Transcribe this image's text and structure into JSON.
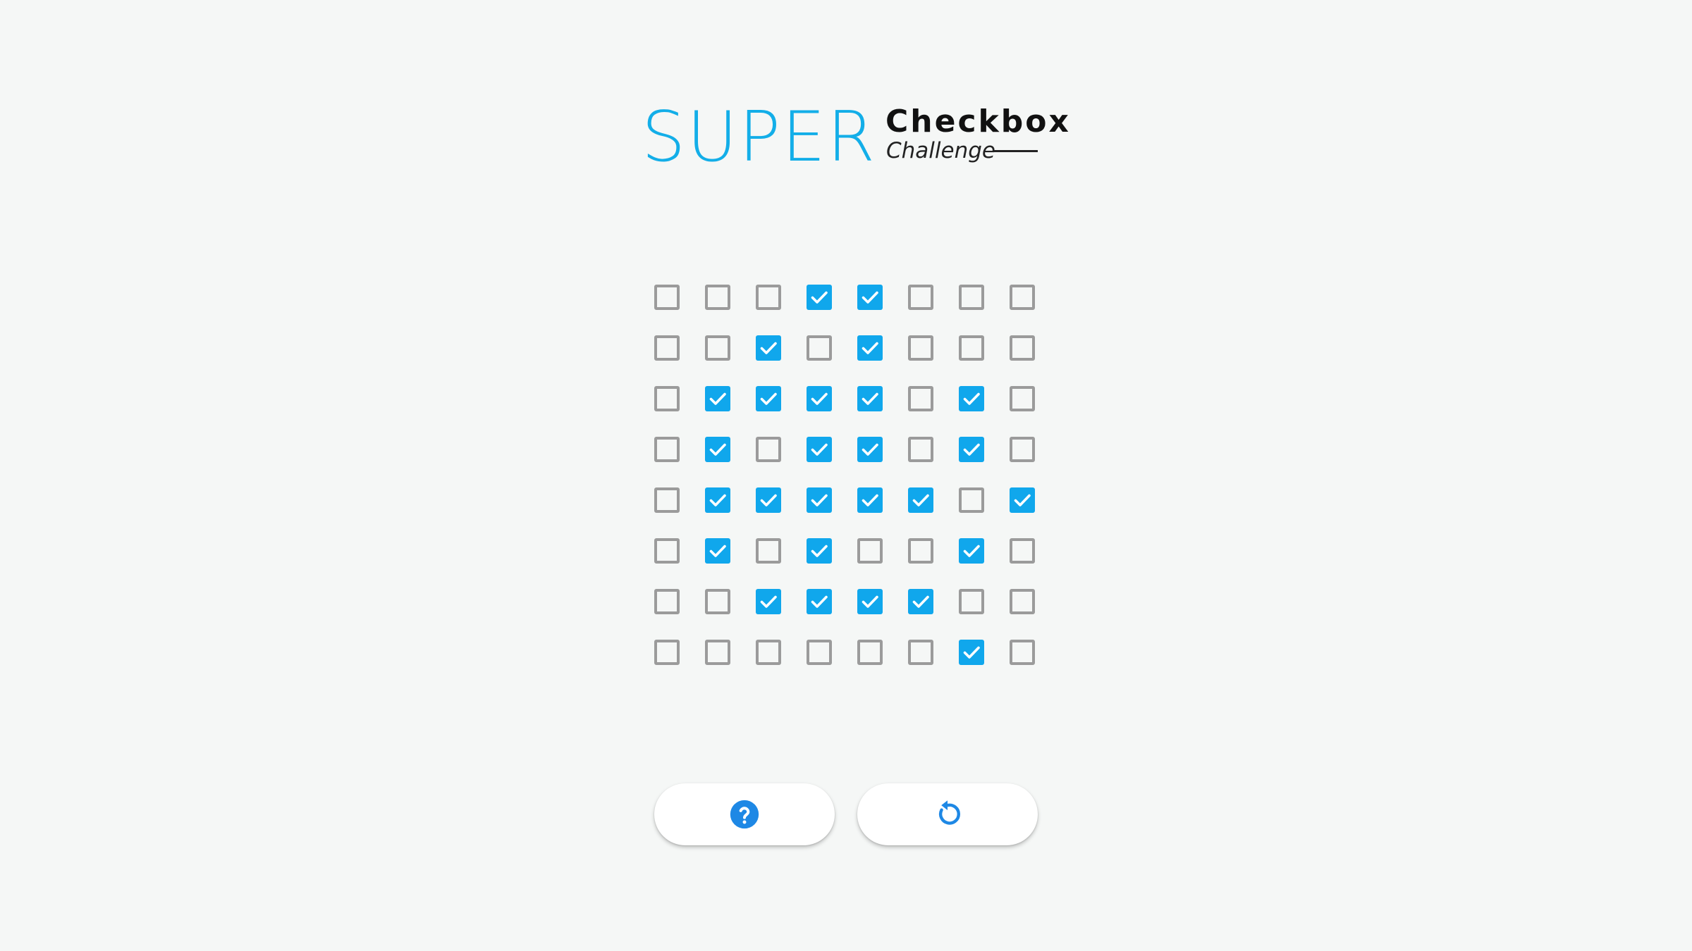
{
  "logo": {
    "super": "SUPER",
    "checkbox": "Checkbox",
    "challenge": "Challenge"
  },
  "colors": {
    "accent": "#13aee8",
    "checked": "#10a7ec",
    "unchecked_border": "#9b9b9b",
    "background": "#f5f7f6",
    "button_icon": "#1e88e5"
  },
  "grid": {
    "rows": 8,
    "cols": 8,
    "checked": [
      [
        0,
        0,
        0,
        1,
        1,
        0,
        0,
        0
      ],
      [
        0,
        0,
        1,
        0,
        1,
        0,
        0,
        0
      ],
      [
        0,
        1,
        1,
        1,
        1,
        0,
        1,
        0
      ],
      [
        0,
        1,
        0,
        1,
        1,
        0,
        1,
        0
      ],
      [
        0,
        1,
        1,
        1,
        1,
        1,
        0,
        1
      ],
      [
        0,
        1,
        0,
        1,
        0,
        0,
        1,
        0
      ],
      [
        0,
        0,
        1,
        1,
        1,
        1,
        0,
        0
      ],
      [
        0,
        0,
        0,
        0,
        0,
        0,
        1,
        0
      ]
    ]
  },
  "buttons": {
    "help_icon": "help-circle-icon",
    "reset_icon": "reset-arrow-icon"
  }
}
